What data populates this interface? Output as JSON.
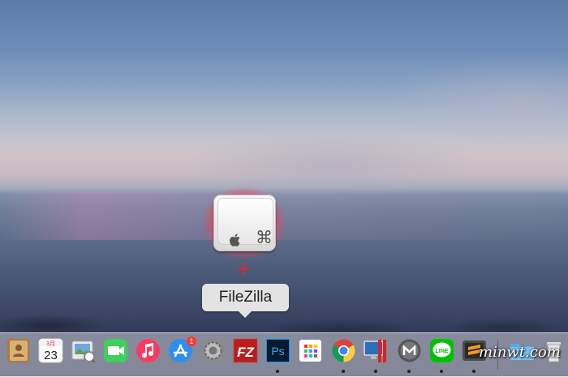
{
  "tooltip": {
    "label": "FileZilla"
  },
  "drag_preview": {
    "icon": "keyboard-key-icon",
    "command_symbol": "⌘",
    "drop_indicator": "plus-icon"
  },
  "dock": {
    "items": [
      {
        "name": "contacts-icon",
        "running": false
      },
      {
        "name": "calendar-icon",
        "month": "3月",
        "day": "23",
        "running": false
      },
      {
        "name": "preview-icon",
        "running": false
      },
      {
        "name": "facetime-icon",
        "running": false
      },
      {
        "name": "itunes-icon",
        "running": false
      },
      {
        "name": "app-store-icon",
        "badge": "1",
        "running": false
      },
      {
        "name": "system-preferences-icon",
        "running": false
      },
      {
        "name": "filezilla-icon",
        "label": "FZ",
        "running": false
      },
      {
        "name": "photoshop-icon",
        "label": "Ps",
        "running": true
      },
      {
        "name": "launchpad-icon",
        "running": false
      },
      {
        "name": "chrome-icon",
        "running": true
      },
      {
        "name": "screen-sharing-icon",
        "running": true
      },
      {
        "name": "macdown-icon",
        "running": true
      },
      {
        "name": "line-icon",
        "label": "LINE",
        "running": true
      },
      {
        "name": "sublime-text-icon",
        "running": true
      },
      {
        "name": "folder-icon",
        "running": false
      },
      {
        "name": "trash-icon",
        "running": false
      }
    ]
  },
  "watermark": {
    "text": "minwt.com"
  }
}
